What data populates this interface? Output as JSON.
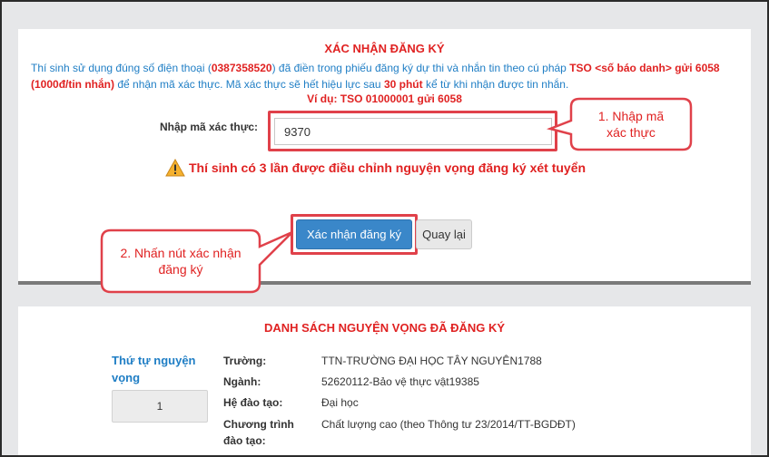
{
  "confirm": {
    "title": "XÁC NHẬN ĐĂNG KÝ",
    "info_part1": "Thí sinh sử dụng đúng số điện thoại (",
    "phone": "0387358520",
    "info_part2": ") đã điền trong phiếu đăng ký dự thi và nhắn tin theo cú pháp ",
    "syntax": "TSO <số báo danh> gửi 6058 (1000đ/tin nhắn)",
    "info_part3": " để nhận mã xác thực. Mã xác thực sẽ hết hiệu lực sau ",
    "expiry": "30 phút",
    "info_part4": " kể từ khi nhận được tin nhắn.",
    "example": "Ví dụ: TSO 01000001 gửi 6058",
    "code_label": "Nhập mã xác thực:",
    "code_value": "9370",
    "warning": "Thí sinh có 3 lần được điều chỉnh nguyện vọng đăng ký xét tuyển",
    "confirm_button": "Xác nhận đăng ký",
    "back_button": "Quay lại"
  },
  "callouts": {
    "step1_line1": "1. Nhập mã",
    "step1_line2": "xác thực",
    "step2_line1": "2. Nhấn nút xác nhận",
    "step2_line2": "đăng ký"
  },
  "list": {
    "title": "DANH SÁCH NGUYỆN VỌNG ĐÃ ĐĂNG KÝ",
    "order_label_line1": "Thứ tự nguyện",
    "order_label_line2": "vọng",
    "order_value": "1",
    "fields": [
      {
        "key": "Trường:",
        "value": "TTN-TRƯỜNG ĐẠI HỌC TÂY NGUYÊN1788"
      },
      {
        "key": "Ngành:",
        "value": "52620112-Bảo vệ thực vật19385"
      },
      {
        "key": "Hệ đào tạo:",
        "value": "Đại học"
      },
      {
        "key": "Chương trình",
        "key2": "đào tạo:",
        "value": "Chất lượng cao (theo Thông tư 23/2014/TT-BGDĐT)"
      }
    ]
  },
  "colors": {
    "accent_red": "#e02222",
    "info_blue": "#1f7ec5",
    "button_blue": "#3a87c9",
    "highlight_red": "#e0414a"
  }
}
